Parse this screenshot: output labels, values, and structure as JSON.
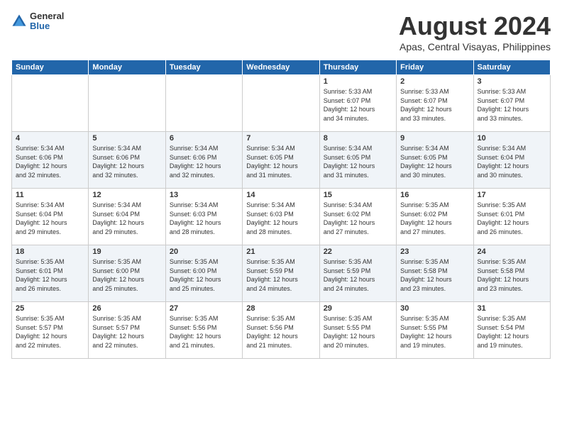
{
  "logo": {
    "general": "General",
    "blue": "Blue"
  },
  "header": {
    "month": "August 2024",
    "location": "Apas, Central Visayas, Philippines"
  },
  "weekdays": [
    "Sunday",
    "Monday",
    "Tuesday",
    "Wednesday",
    "Thursday",
    "Friday",
    "Saturday"
  ],
  "weeks": [
    [
      {
        "day": "",
        "info": ""
      },
      {
        "day": "",
        "info": ""
      },
      {
        "day": "",
        "info": ""
      },
      {
        "day": "",
        "info": ""
      },
      {
        "day": "1",
        "info": "Sunrise: 5:33 AM\nSunset: 6:07 PM\nDaylight: 12 hours\nand 34 minutes."
      },
      {
        "day": "2",
        "info": "Sunrise: 5:33 AM\nSunset: 6:07 PM\nDaylight: 12 hours\nand 33 minutes."
      },
      {
        "day": "3",
        "info": "Sunrise: 5:33 AM\nSunset: 6:07 PM\nDaylight: 12 hours\nand 33 minutes."
      }
    ],
    [
      {
        "day": "4",
        "info": "Sunrise: 5:34 AM\nSunset: 6:06 PM\nDaylight: 12 hours\nand 32 minutes."
      },
      {
        "day": "5",
        "info": "Sunrise: 5:34 AM\nSunset: 6:06 PM\nDaylight: 12 hours\nand 32 minutes."
      },
      {
        "day": "6",
        "info": "Sunrise: 5:34 AM\nSunset: 6:06 PM\nDaylight: 12 hours\nand 32 minutes."
      },
      {
        "day": "7",
        "info": "Sunrise: 5:34 AM\nSunset: 6:05 PM\nDaylight: 12 hours\nand 31 minutes."
      },
      {
        "day": "8",
        "info": "Sunrise: 5:34 AM\nSunset: 6:05 PM\nDaylight: 12 hours\nand 31 minutes."
      },
      {
        "day": "9",
        "info": "Sunrise: 5:34 AM\nSunset: 6:05 PM\nDaylight: 12 hours\nand 30 minutes."
      },
      {
        "day": "10",
        "info": "Sunrise: 5:34 AM\nSunset: 6:04 PM\nDaylight: 12 hours\nand 30 minutes."
      }
    ],
    [
      {
        "day": "11",
        "info": "Sunrise: 5:34 AM\nSunset: 6:04 PM\nDaylight: 12 hours\nand 29 minutes."
      },
      {
        "day": "12",
        "info": "Sunrise: 5:34 AM\nSunset: 6:04 PM\nDaylight: 12 hours\nand 29 minutes."
      },
      {
        "day": "13",
        "info": "Sunrise: 5:34 AM\nSunset: 6:03 PM\nDaylight: 12 hours\nand 28 minutes."
      },
      {
        "day": "14",
        "info": "Sunrise: 5:34 AM\nSunset: 6:03 PM\nDaylight: 12 hours\nand 28 minutes."
      },
      {
        "day": "15",
        "info": "Sunrise: 5:34 AM\nSunset: 6:02 PM\nDaylight: 12 hours\nand 27 minutes."
      },
      {
        "day": "16",
        "info": "Sunrise: 5:35 AM\nSunset: 6:02 PM\nDaylight: 12 hours\nand 27 minutes."
      },
      {
        "day": "17",
        "info": "Sunrise: 5:35 AM\nSunset: 6:01 PM\nDaylight: 12 hours\nand 26 minutes."
      }
    ],
    [
      {
        "day": "18",
        "info": "Sunrise: 5:35 AM\nSunset: 6:01 PM\nDaylight: 12 hours\nand 26 minutes."
      },
      {
        "day": "19",
        "info": "Sunrise: 5:35 AM\nSunset: 6:00 PM\nDaylight: 12 hours\nand 25 minutes."
      },
      {
        "day": "20",
        "info": "Sunrise: 5:35 AM\nSunset: 6:00 PM\nDaylight: 12 hours\nand 25 minutes."
      },
      {
        "day": "21",
        "info": "Sunrise: 5:35 AM\nSunset: 5:59 PM\nDaylight: 12 hours\nand 24 minutes."
      },
      {
        "day": "22",
        "info": "Sunrise: 5:35 AM\nSunset: 5:59 PM\nDaylight: 12 hours\nand 24 minutes."
      },
      {
        "day": "23",
        "info": "Sunrise: 5:35 AM\nSunset: 5:58 PM\nDaylight: 12 hours\nand 23 minutes."
      },
      {
        "day": "24",
        "info": "Sunrise: 5:35 AM\nSunset: 5:58 PM\nDaylight: 12 hours\nand 23 minutes."
      }
    ],
    [
      {
        "day": "25",
        "info": "Sunrise: 5:35 AM\nSunset: 5:57 PM\nDaylight: 12 hours\nand 22 minutes."
      },
      {
        "day": "26",
        "info": "Sunrise: 5:35 AM\nSunset: 5:57 PM\nDaylight: 12 hours\nand 22 minutes."
      },
      {
        "day": "27",
        "info": "Sunrise: 5:35 AM\nSunset: 5:56 PM\nDaylight: 12 hours\nand 21 minutes."
      },
      {
        "day": "28",
        "info": "Sunrise: 5:35 AM\nSunset: 5:56 PM\nDaylight: 12 hours\nand 21 minutes."
      },
      {
        "day": "29",
        "info": "Sunrise: 5:35 AM\nSunset: 5:55 PM\nDaylight: 12 hours\nand 20 minutes."
      },
      {
        "day": "30",
        "info": "Sunrise: 5:35 AM\nSunset: 5:55 PM\nDaylight: 12 hours\nand 19 minutes."
      },
      {
        "day": "31",
        "info": "Sunrise: 5:35 AM\nSunset: 5:54 PM\nDaylight: 12 hours\nand 19 minutes."
      }
    ]
  ]
}
